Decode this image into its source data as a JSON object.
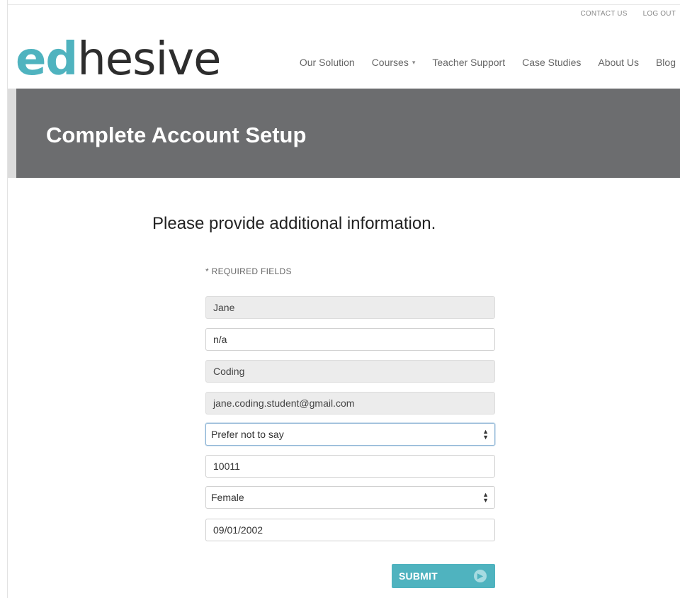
{
  "header": {
    "utility_links": [
      "CONTACT US",
      "LOG OUT"
    ],
    "logo": {
      "part1": "ed",
      "part2": "hesive"
    },
    "nav": [
      {
        "label": "Our Solution"
      },
      {
        "label": "Courses"
      },
      {
        "label": "Teacher Support"
      },
      {
        "label": "Case Studies"
      },
      {
        "label": "About Us"
      },
      {
        "label": "Blog"
      }
    ]
  },
  "banner": {
    "title": "Complete Account Setup"
  },
  "form": {
    "subtitle": "Please provide additional information.",
    "required_note": "* REQUIRED FIELDS",
    "fields": [
      {
        "value": "Jane",
        "disabled": true
      },
      {
        "value": "n/a"
      },
      {
        "value": "Coding",
        "disabled": true
      },
      {
        "value": "jane.coding.student@gmail.com",
        "disabled": true
      },
      {
        "value": "Prefer not to say",
        "type": "select"
      },
      {
        "value": "10011"
      },
      {
        "value": "Female",
        "type": "select"
      },
      {
        "value": "09/01/2002"
      }
    ],
    "submit_label": "SUBMIT"
  },
  "colors": {
    "accent": "#4fb3bf",
    "banner": "#6c6d6f",
    "disabled_field": "#ececec"
  },
  "icons": {
    "courses_caret": "caret-down-icon",
    "select_arrows": "updown-arrows-icon",
    "submit_arrow": "arrow-right-circle-icon"
  }
}
